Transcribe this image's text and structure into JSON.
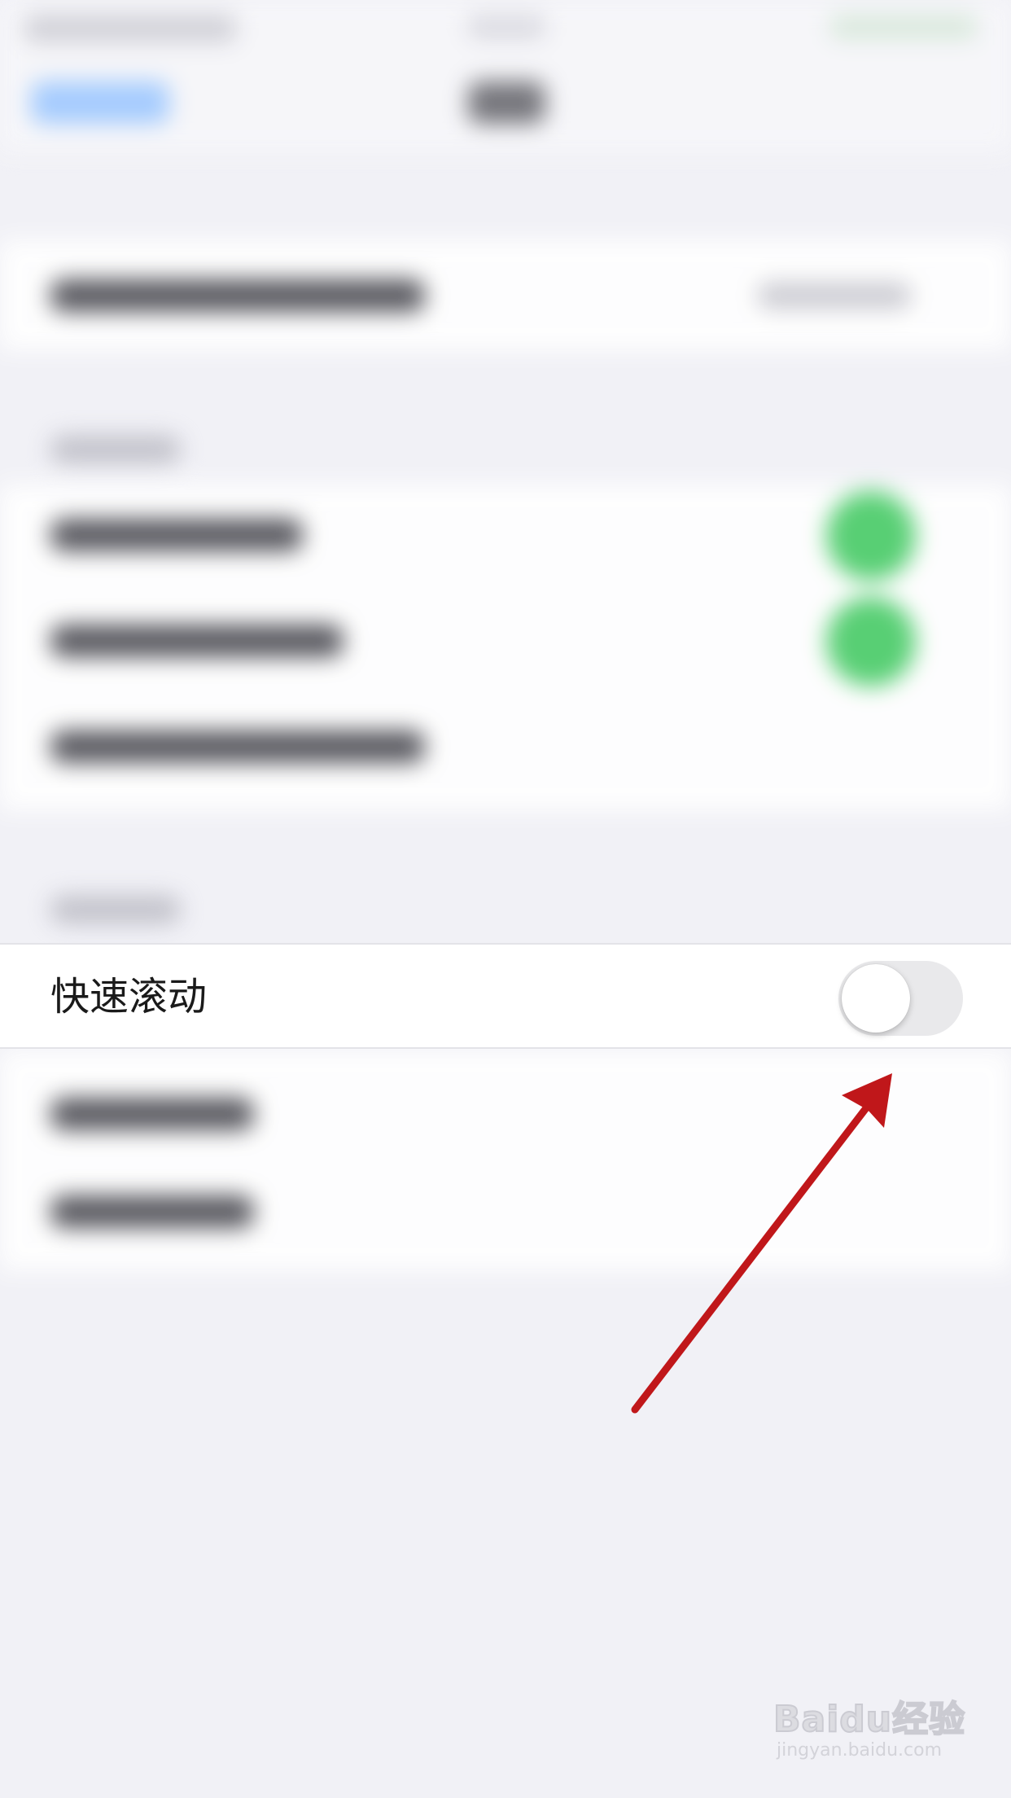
{
  "row": {
    "label": "快速滚动",
    "toggle_on": false
  },
  "colors": {
    "toggle_off_track": "#e9e9eb",
    "arrow": "#c0171a",
    "background": "#f1f1f6"
  },
  "watermark": {
    "logo": "Baidu经验",
    "url": "jingyan.baidu.com"
  }
}
